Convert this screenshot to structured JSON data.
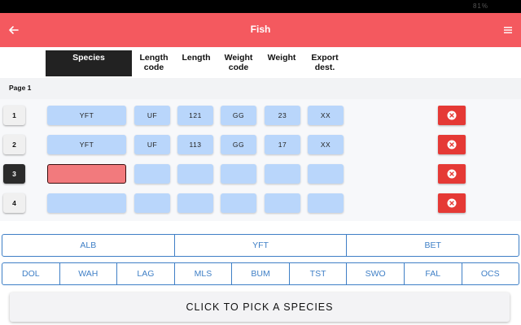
{
  "status": {
    "text": "81%"
  },
  "app": {
    "title": "Fish",
    "accent": "#f4595f"
  },
  "columns": [
    {
      "label": "Species",
      "active": true
    },
    {
      "label": "Length\ncode",
      "active": false
    },
    {
      "label": "Length",
      "active": false
    },
    {
      "label": "Weight\ncode",
      "active": false
    },
    {
      "label": "Weight",
      "active": false
    },
    {
      "label": "Export\ndest.",
      "active": false
    }
  ],
  "page": {
    "label": "Page 1"
  },
  "rows": [
    {
      "num": "1",
      "active": false,
      "cells": [
        "YFT",
        "UF",
        "121",
        "GG",
        "23",
        "XX"
      ]
    },
    {
      "num": "2",
      "active": false,
      "cells": [
        "YFT",
        "UF",
        "113",
        "GG",
        "17",
        "XX"
      ]
    },
    {
      "num": "3",
      "active": true,
      "cells": [
        "",
        "",
        "",
        "",
        "",
        ""
      ]
    },
    {
      "num": "4",
      "active": false,
      "cells": [
        "",
        "",
        "",
        "",
        "",
        ""
      ]
    }
  ],
  "quick_primary": [
    "ALB",
    "YFT",
    "BET"
  ],
  "quick_secondary": [
    "DOL",
    "WAH",
    "LAG",
    "MLS",
    "BUM",
    "TST",
    "SWO",
    "FAL",
    "OCS"
  ],
  "pick_button": {
    "label": "CLICK TO PICK A SPECIES"
  }
}
